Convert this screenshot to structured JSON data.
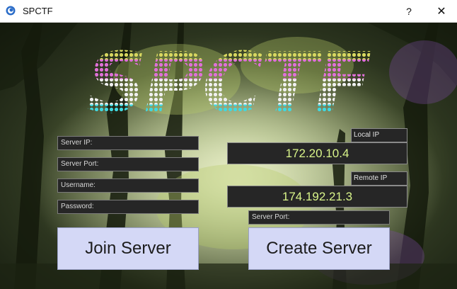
{
  "window": {
    "title": "SPCTF",
    "help_label": "?",
    "close_label": "✕",
    "icon": "app-logo-icon"
  },
  "logo": {
    "text": "SPCTF",
    "stripe_colors": [
      "#d8d860",
      "#e070d8",
      "#f0f0f0",
      "#40d8e0"
    ]
  },
  "join": {
    "server_ip_placeholder": "Server IP:",
    "server_port_placeholder": "Server Port:",
    "username_placeholder": "Username:",
    "password_placeholder": "Password:",
    "button_label": "Join Server"
  },
  "host": {
    "local_ip_label": "Local IP",
    "local_ip_value": "172.20.10.4",
    "remote_ip_label": "Remote IP",
    "remote_ip_value": "174.192.21.3",
    "server_port_placeholder": "Server Port:",
    "button_label": "Create Server"
  },
  "colors": {
    "field_bg": "#262626",
    "ip_text": "#d9f58a",
    "button_bg": "#d4d8f6"
  }
}
